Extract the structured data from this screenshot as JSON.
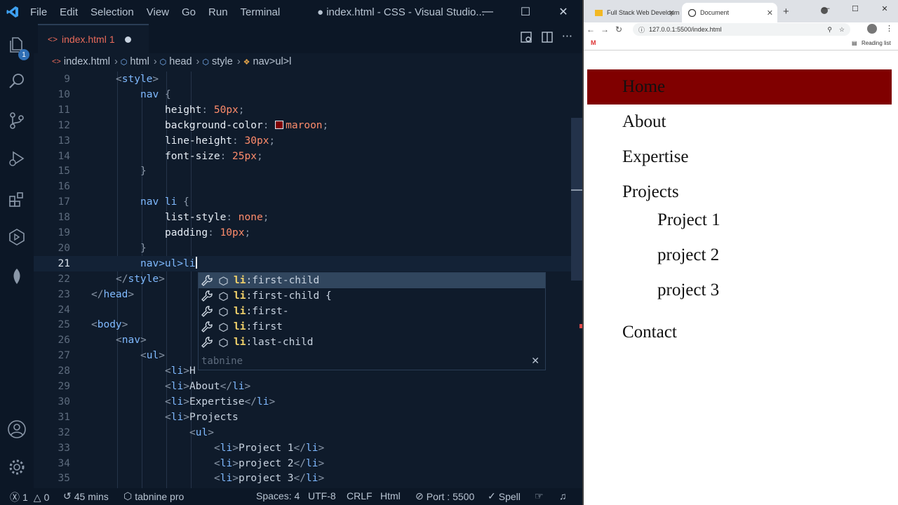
{
  "vscode": {
    "menu": [
      "File",
      "Edit",
      "Selection",
      "View",
      "Go",
      "Run",
      "Terminal"
    ],
    "window_title": "● index.html - CSS - Visual Studio...",
    "tab": {
      "name": "index.html",
      "problems": "1"
    },
    "breadcrumb": [
      "index.html",
      "html",
      "head",
      "style",
      "nav>ul>l"
    ],
    "explorer_badge": "1",
    "lines": [
      {
        "n": "9",
        "indent": 1,
        "code": "<style>"
      },
      {
        "n": "10",
        "indent": 2,
        "code": "nav {"
      },
      {
        "n": "11",
        "indent": 3,
        "code": "height: 50px;"
      },
      {
        "n": "12",
        "indent": 3,
        "code": "background-color: maroon;"
      },
      {
        "n": "13",
        "indent": 3,
        "code": "line-height: 30px;"
      },
      {
        "n": "14",
        "indent": 3,
        "code": "font-size: 25px;"
      },
      {
        "n": "15",
        "indent": 2,
        "code": "}"
      },
      {
        "n": "16",
        "indent": 0,
        "code": ""
      },
      {
        "n": "17",
        "indent": 2,
        "code": "nav li {"
      },
      {
        "n": "18",
        "indent": 3,
        "code": "list-style: none;"
      },
      {
        "n": "19",
        "indent": 3,
        "code": "padding: 10px;"
      },
      {
        "n": "20",
        "indent": 2,
        "code": "}"
      },
      {
        "n": "21",
        "indent": 2,
        "code": "nav>ul>li",
        "current": true
      },
      {
        "n": "22",
        "indent": 1,
        "code": "</style>"
      },
      {
        "n": "23",
        "indent": 0,
        "code": "</head>"
      },
      {
        "n": "24",
        "indent": 0,
        "code": ""
      },
      {
        "n": "25",
        "indent": 0,
        "code": "<body>"
      },
      {
        "n": "26",
        "indent": 1,
        "code": "<nav>"
      },
      {
        "n": "27",
        "indent": 2,
        "code": "<ul>"
      },
      {
        "n": "28",
        "indent": 3,
        "code": "<li>H"
      },
      {
        "n": "29",
        "indent": 3,
        "code": "<li>About</li>"
      },
      {
        "n": "30",
        "indent": 3,
        "code": "<li>Expertise</li>"
      },
      {
        "n": "31",
        "indent": 3,
        "code": "<li>Projects"
      },
      {
        "n": "32",
        "indent": 4,
        "code": "<ul>"
      },
      {
        "n": "33",
        "indent": 5,
        "code": "<li>Project 1</li>"
      },
      {
        "n": "34",
        "indent": 5,
        "code": "<li>project 2</li>"
      },
      {
        "n": "35",
        "indent": 5,
        "code": "<li>project 3</li>"
      }
    ],
    "suggestions": [
      {
        "match": "li",
        "rest": ":first-child",
        "active": true
      },
      {
        "match": "li",
        "rest": ":first-child {",
        "active": false
      },
      {
        "match": "li",
        "rest": ":first-",
        "active": false
      },
      {
        "match": "li",
        "rest": ":first",
        "active": false
      },
      {
        "match": "li",
        "rest": ":last-child",
        "active": false
      }
    ],
    "suggest_footer": "tabnine",
    "status": {
      "errors": "1",
      "warnings": "0",
      "time": "45 mins",
      "tabnine": "tabnine pro",
      "spaces": "Spaces: 4",
      "encoding": "UTF-8",
      "eol": "CRLF",
      "language": "Html",
      "port": "Port : 5500",
      "spell": "Spell"
    }
  },
  "browser": {
    "tabs": [
      {
        "title": "Full Stack Web Developme",
        "active": false
      },
      {
        "title": "Document",
        "active": true
      }
    ],
    "url": "127.0.0.1:5500/index.html",
    "reading_list": "Reading list",
    "page": {
      "nav_items": [
        "Home",
        "About",
        "Expertise",
        "Projects"
      ],
      "sub_items": [
        "Project 1",
        "project 2",
        "project 3"
      ],
      "last_item": "Contact",
      "nav_bg": "#800000"
    }
  }
}
